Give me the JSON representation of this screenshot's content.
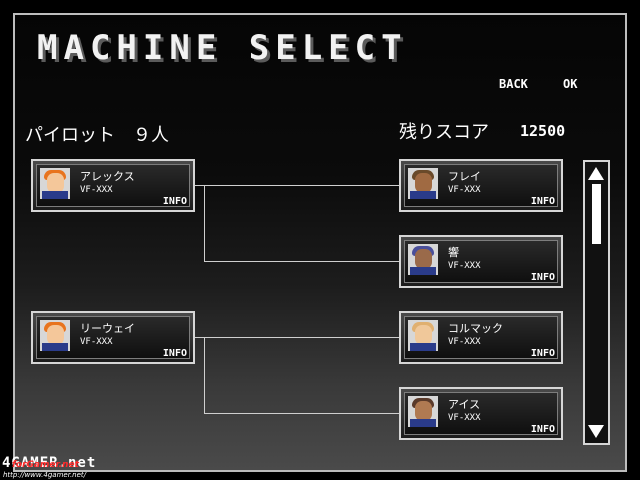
{
  "header": {
    "title": "MACHINE SELECT",
    "back_label": "BACK",
    "ok_label": "OK"
  },
  "pilot_count": "パイロット　９人",
  "score": {
    "label": "残りスコア",
    "value": "12500"
  },
  "left_cards": [
    {
      "name": "アレックス",
      "model": "VF-XXX",
      "info": "INFO",
      "hair": "#e8741e",
      "skin": "#f4c79a"
    },
    {
      "name": "リーウェイ",
      "model": "VF-XXX",
      "info": "INFO",
      "hair": "#e8741e",
      "skin": "#f4c79a"
    }
  ],
  "right_cards": [
    {
      "name": "フレイ",
      "model": "VF-XXX",
      "info": "INFO",
      "hair": "#6a4a2a",
      "skin": "#a06a42"
    },
    {
      "name": "響",
      "model": "VF-XXX",
      "info": "INFO",
      "hair": "#4a4f9a",
      "skin": "#9a6a4a"
    },
    {
      "name": "コルマック",
      "model": "VF-XXX",
      "info": "INFO",
      "hair": "#e0b070",
      "skin": "#f0c89a"
    },
    {
      "name": "アイス",
      "model": "VF-XXX",
      "info": "INFO",
      "hair": "#5a3a2a",
      "skin": "#b07a52"
    }
  ],
  "watermark": {
    "logo": "4GAMER.net",
    "tag": "forGamer.net",
    "url": "http://www.4gamer.net/"
  }
}
